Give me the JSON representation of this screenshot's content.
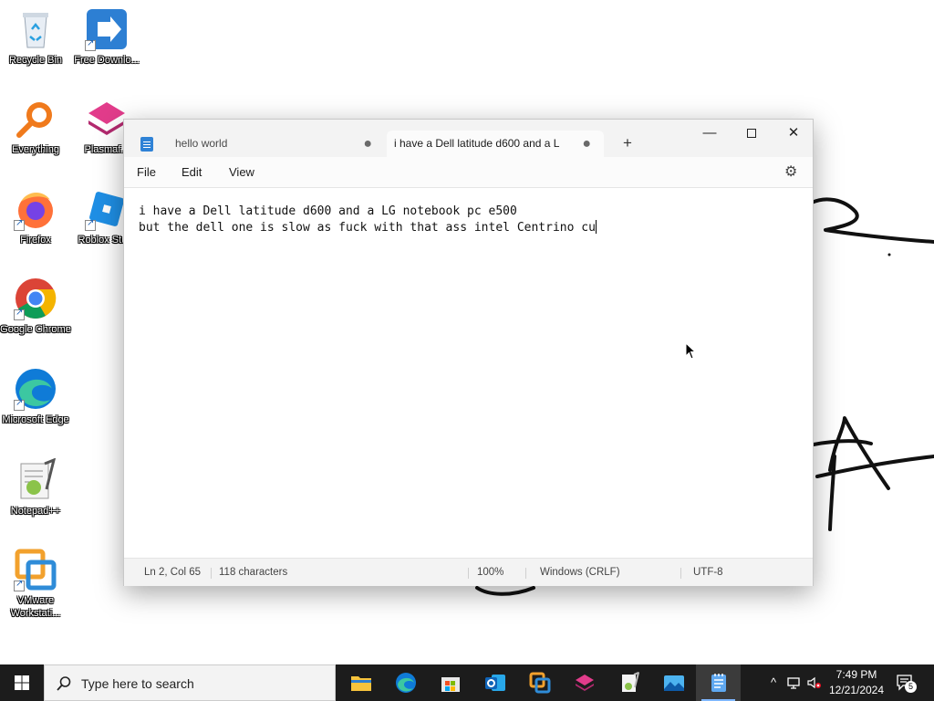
{
  "desktop": {
    "icons": [
      {
        "label": "Recycle Bin",
        "icon": "recycle-bin-icon"
      },
      {
        "label": "Free Downlo...",
        "icon": "free-download-manager-icon"
      },
      {
        "label": "Everything",
        "icon": "everything-search-icon"
      },
      {
        "label": "Plasmaf...",
        "icon": "plasma-icon"
      },
      {
        "label": "Firefox",
        "icon": "firefox-icon"
      },
      {
        "label": "Roblox Stu...",
        "icon": "roblox-studio-icon"
      },
      {
        "label": "Google Chrome",
        "icon": "chrome-icon"
      },
      {
        "label": "Microsoft Edge",
        "icon": "edge-icon"
      },
      {
        "label": "Notepad++",
        "icon": "notepad-plus-plus-icon"
      },
      {
        "label": "VMware Workstati...",
        "icon": "vmware-icon"
      }
    ]
  },
  "notepad": {
    "tabs": [
      {
        "title": "hello world",
        "modified": "●"
      },
      {
        "title": "i have a Dell latitude d600 and a L",
        "modified": "●"
      }
    ],
    "new_tab": "+",
    "controls": {
      "minimize": "—",
      "close": "✕"
    },
    "menu": {
      "file": "File",
      "edit": "Edit",
      "view": "View"
    },
    "content": {
      "line1": "i have a Dell latitude d600 and a LG notebook pc e500",
      "line2": "but the dell one is slow as fuck with that ass intel Centrino cu"
    },
    "status": {
      "position": "Ln 2, Col 65",
      "characters": "118 characters",
      "zoom": "100%",
      "line_ending": "Windows (CRLF)",
      "encoding": "UTF-8"
    }
  },
  "taskbar": {
    "search_placeholder": "Type here to search",
    "apps": [
      "file-explorer-icon",
      "edge-icon",
      "microsoft-store-icon",
      "outlook-icon",
      "vmware-icon",
      "plasma-icon",
      "notepad-plus-plus-icon",
      "photos-icon",
      "notepad-icon"
    ],
    "clock": {
      "time": "7:49 PM",
      "date": "12/21/2024"
    },
    "notification_count": "5",
    "tray": {
      "chevron": "^"
    }
  },
  "colors": {
    "taskbar": "#1c1c1c",
    "accent": "#2f82d6",
    "window": "#f3f3f3"
  }
}
